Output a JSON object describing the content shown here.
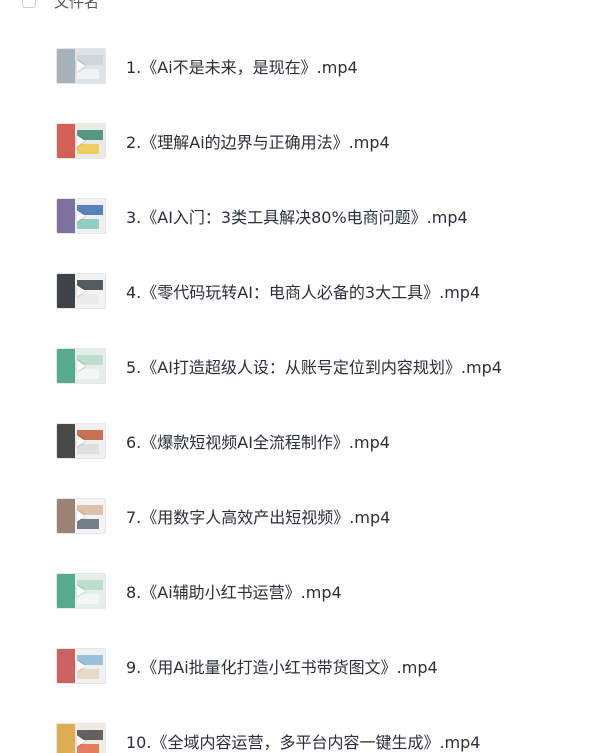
{
  "header": {
    "column_label": "文件名"
  },
  "files": [
    {
      "name": "1.《Ai不是未来，是现在》.mp4",
      "thumb": [
        "#dfe3e6",
        "#9ea8b0",
        "#c9d3d8",
        "#f2f4f5"
      ]
    },
    {
      "name": "2.《理解Ai的边界与正确用法》.mp4",
      "thumb": [
        "#e9e9e6",
        "#d0473c",
        "#3a8a6e",
        "#f1c84b"
      ]
    },
    {
      "name": "3.《AI入门：3类工具解决80%电商问题》.mp4",
      "thumb": [
        "#eef1f0",
        "#6b5a8e",
        "#3f6fb0",
        "#7fc8b8"
      ]
    },
    {
      "name": "4.《零代码玩转AI：电商人必备的3大工具》.mp4",
      "thumb": [
        "#f3f3f3",
        "#1f2328",
        "#3a3f45",
        "#e9e9e9"
      ]
    },
    {
      "name": "5.《AI打造超级人设：从账号定位到内容规划》.mp4",
      "thumb": [
        "#e4efe9",
        "#3d9e7e",
        "#b7d9cb",
        "#f5f7f6"
      ]
    },
    {
      "name": "6.《爆款短视频AI全流程制作》.mp4",
      "thumb": [
        "#f0f0f0",
        "#2a2a2a",
        "#c05b3c",
        "#dcdcdc"
      ]
    },
    {
      "name": "7.《用数字人高效产出短视频》.mp4",
      "thumb": [
        "#f4f4f4",
        "#8a6f5a",
        "#d9b9a0",
        "#5c6b78"
      ]
    },
    {
      "name": "8.《Ai辅助小红书运营》.mp4",
      "thumb": [
        "#e4efe9",
        "#3d9e7e",
        "#b7d9cb",
        "#f5f7f6"
      ]
    },
    {
      "name": "9.《用Ai批量化打造小红书带货图文》.mp4",
      "thumb": [
        "#f1f1f1",
        "#c44a4a",
        "#8bb8d6",
        "#e8d6c0"
      ]
    },
    {
      "name": "10.《全域内容运营，多平台内容一键生成》.mp4",
      "thumb": [
        "#f0ece4",
        "#d8a23a",
        "#4a4a4a",
        "#e26a4a"
      ]
    }
  ]
}
